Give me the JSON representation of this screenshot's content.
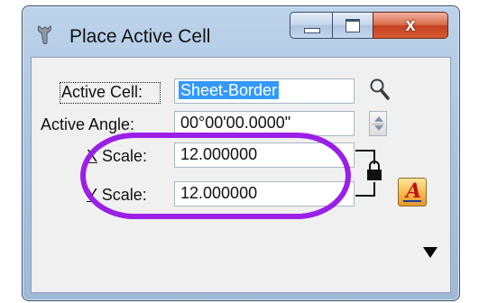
{
  "window": {
    "title": "Place Active Cell",
    "icons": {
      "app": "wrench-cell-icon",
      "close": "x-glyph"
    },
    "close_glyph": "x"
  },
  "form": {
    "active_cell": {
      "label": "Active Cell:",
      "value": "Sheet-Border"
    },
    "active_angle": {
      "label": "Active Angle:",
      "value": "00°00'00.0000\""
    },
    "x_scale": {
      "label_accel": "X",
      "label_rest": " Scale:",
      "value": "12.000000"
    },
    "y_scale": {
      "label_accel": "Y",
      "label_rest": " Scale:",
      "value": "12.000000"
    }
  },
  "tools": {
    "browse_icon": "magnifier-icon",
    "lock_icon": "lock-icon",
    "text_icon": "text-style-icon",
    "text_icon_letter": "A",
    "more_icon": "down-triangle-icon"
  },
  "annotation": {
    "color": "#9b1fe6"
  }
}
